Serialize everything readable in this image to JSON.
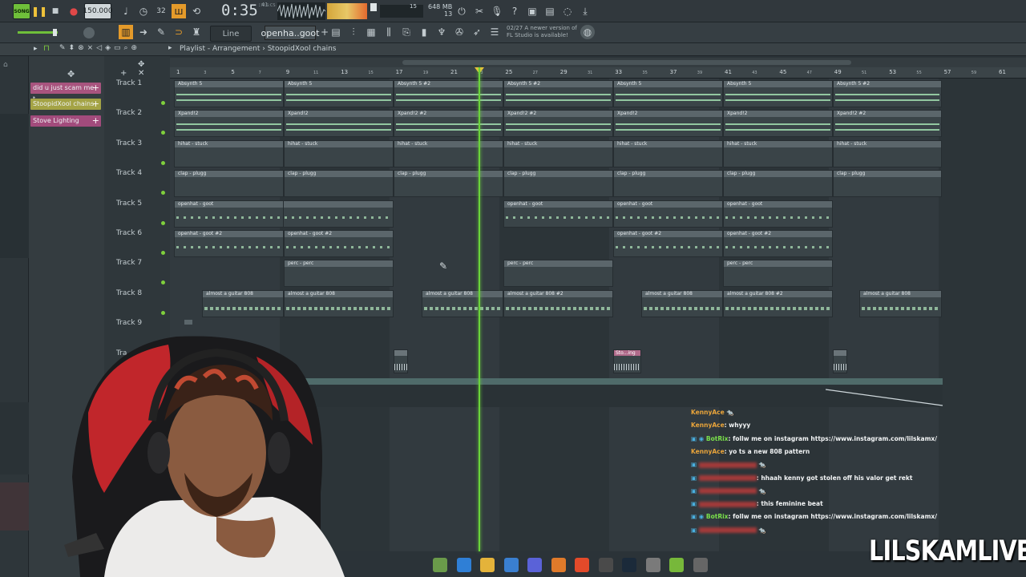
{
  "topbar": {
    "song_mode": "SONG",
    "tempo": "150.000",
    "time": "0:35",
    "time_frac": ":41",
    "time_unit": "M:S:CS",
    "cpu_value": "15",
    "memory": "648 MB",
    "memory_sub": "13"
  },
  "toolbar2": {
    "snap_mode": "Line",
    "pattern_name": "openha..goot",
    "hint_line1": "02/27  A newer version of",
    "hint_line2": "FL Studio is available!"
  },
  "playlist": {
    "title": "Playlist - Arrangement",
    "arrangement": "StoopidXool chains",
    "pattern_picker": [
      {
        "label": "did u just scam me t...",
        "color": "#a8547e"
      },
      {
        "label": "StoopidXool chains",
        "color": "#a4a345"
      },
      {
        "label": "Stove Lighting",
        "color": "#a24b7c"
      }
    ],
    "ruler": [
      "1",
      "5",
      "9",
      "13",
      "17",
      "21",
      "25",
      "29",
      "33",
      "37",
      "41",
      "45",
      "49",
      "53",
      "57",
      "61"
    ],
    "ruler_minor": [
      "3",
      "7",
      "11",
      "15",
      "19",
      "23",
      "27",
      "31",
      "35",
      "39",
      "43",
      "47",
      "51",
      "55",
      "59"
    ],
    "tracks": [
      {
        "name": "Track 1"
      },
      {
        "name": "Track 2"
      },
      {
        "name": "Track 3"
      },
      {
        "name": "Track 4"
      },
      {
        "name": "Track 5"
      },
      {
        "name": "Track 6"
      },
      {
        "name": "Track 7"
      },
      {
        "name": "Track 8"
      },
      {
        "name": "Track 9"
      },
      {
        "name": "Tra"
      }
    ],
    "clips": {
      "t1": [
        "Absynth 5",
        "Absynth 5",
        "Absynth 5 #2",
        "Absynth 5 #2",
        "Absynth 5",
        "Absynth 5",
        "Absynth 5 #2"
      ],
      "t2": [
        "Xpand!2",
        "Xpand!2",
        "Xpand!2 #2",
        "Xpand!2 #2",
        "Xpand!2",
        "Xpand!2",
        "Xpand!2 #2"
      ],
      "t3": [
        "hihat - stuck",
        "hihat - stuck",
        "hihat - stuck",
        "hihat - stuck",
        "hihat - stuck",
        "hihat - stuck",
        "hihat - stuck"
      ],
      "t4": [
        "clap - plugg",
        "clap - plugg",
        "clap - plugg",
        "clap - plugg",
        "clap - plugg",
        "clap - plugg",
        "clap - plugg"
      ],
      "t5": [
        "openhat - goot",
        "openhat - goot",
        "openhat - goot",
        "openhat - goot",
        "openhat - goot"
      ],
      "t6": [
        "openhat - goot #2",
        "openhat - goot #2",
        "openhat - goot #2",
        "openhat - goot #2"
      ],
      "t7": [
        "perc - perc",
        "perc - perc",
        "perc - perc"
      ],
      "t8": [
        "almost a guitar 808",
        "almost a guitar 808",
        "almost a guitar 808",
        "almost a guitar 808 #2",
        "almost a guitar 808",
        "almost a guitar 808 #2",
        "almost a guitar 808"
      ],
      "audio": "Sto...ing"
    }
  },
  "chat": [
    {
      "user": "KennyAce",
      "msg": ""
    },
    {
      "user": "KennyAce",
      "msg": ": whyyy"
    },
    {
      "user": "BotRix",
      "msg": ": follw me on instagram https://www.instagram.com/lilskamx/"
    },
    {
      "user": "KennyAce",
      "msg": ": yo ts a new 808 pattern"
    },
    {
      "user": "",
      "msg": ""
    },
    {
      "user": "",
      "msg": ": hhaah kenny got stolen off his valor get rekt"
    },
    {
      "user": "",
      "msg": ""
    },
    {
      "user": "",
      "msg": ": this feminine beat"
    },
    {
      "user": "BotRix",
      "msg": ": follw me on instagram https://www.instagram.com/lilskamx/"
    },
    {
      "user": "",
      "msg": ""
    }
  ],
  "brand": "LILSKAMLIVE",
  "colors": {
    "playhead": "#6ad43a",
    "accent": "#f0c23a"
  }
}
